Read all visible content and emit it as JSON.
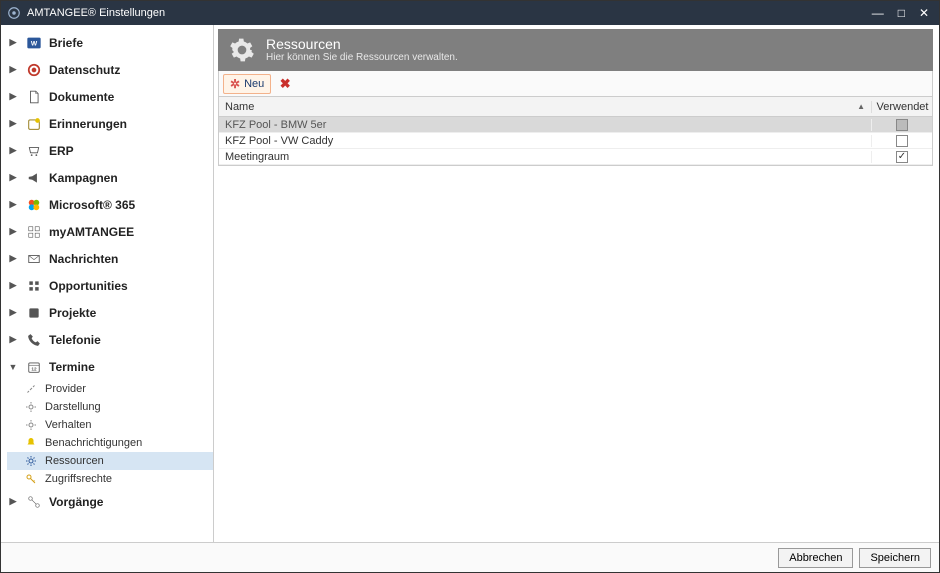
{
  "window": {
    "title": "AMTANGEE® Einstellungen"
  },
  "sidebar": {
    "items": [
      {
        "label": "Briefe",
        "icon": "word-icon",
        "color": "#2b579a"
      },
      {
        "label": "Datenschutz",
        "icon": "record-icon",
        "color": "#d9534f"
      },
      {
        "label": "Dokumente",
        "icon": "document-icon",
        "color": "#555"
      },
      {
        "label": "Erinnerungen",
        "icon": "reminder-icon",
        "color": "#8a6d00"
      },
      {
        "label": "ERP",
        "icon": "cart-icon",
        "color": "#555"
      },
      {
        "label": "Kampagnen",
        "icon": "megaphone-icon",
        "color": "#555"
      },
      {
        "label": "Microsoft® 365",
        "icon": "m365-icon",
        "color": "#2b579a"
      },
      {
        "label": "myAMTANGEE",
        "icon": "dashboard-icon",
        "color": "#555"
      },
      {
        "label": "Nachrichten",
        "icon": "mail-icon",
        "color": "#555"
      },
      {
        "label": "Opportunities",
        "icon": "opportunity-icon",
        "color": "#555"
      },
      {
        "label": "Projekte",
        "icon": "project-icon",
        "color": "#555"
      },
      {
        "label": "Telefonie",
        "icon": "phone-icon",
        "color": "#555"
      },
      {
        "label": "Termine",
        "icon": "calendar-icon",
        "color": "#555",
        "expanded": true,
        "children": [
          {
            "label": "Provider",
            "icon": "link-icon"
          },
          {
            "label": "Darstellung",
            "icon": "gear-small-icon"
          },
          {
            "label": "Verhalten",
            "icon": "gear-small-icon"
          },
          {
            "label": "Benachrichtigungen",
            "icon": "bell-icon"
          },
          {
            "label": "Ressourcen",
            "icon": "gear-blue-icon",
            "selected": true
          },
          {
            "label": "Zugriffsrechte",
            "icon": "key-icon"
          }
        ]
      },
      {
        "label": "Vorgänge",
        "icon": "workflow-icon",
        "color": "#555"
      }
    ]
  },
  "header": {
    "title": "Ressourcen",
    "subtitle": "Hier können Sie die Ressourcen verwalten."
  },
  "toolbar": {
    "new_label": "Neu"
  },
  "grid": {
    "columns": {
      "name": "Name",
      "used": "Verwendet"
    },
    "rows": [
      {
        "name": "KFZ Pool - BMW 5er",
        "used": false,
        "selected": true
      },
      {
        "name": "KFZ Pool - VW Caddy",
        "used": false,
        "selected": false
      },
      {
        "name": "Meetingraum",
        "used": true,
        "selected": false
      }
    ]
  },
  "footer": {
    "cancel": "Abbrechen",
    "save": "Speichern"
  }
}
